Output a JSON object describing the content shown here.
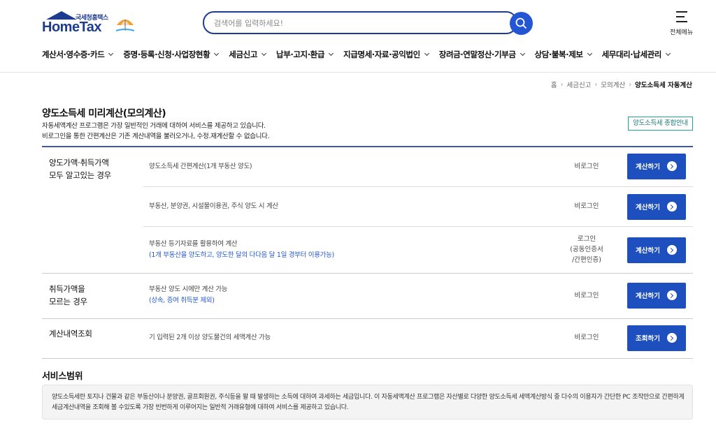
{
  "header": {
    "logo_sub": "국세청홈택스",
    "logo_main": "HomeTax",
    "search_placeholder": "검색어를 입력하세요!",
    "menu_label": "전체메뉴"
  },
  "gnb": [
    {
      "label": "계산서·영수증·카드"
    },
    {
      "label": "증명·등록·신청·사업장현황"
    },
    {
      "label": "세금신고"
    },
    {
      "label": "납부·고지·환급"
    },
    {
      "label": "지급명세·자료·공익법인"
    },
    {
      "label": "장려금·연말정산·기부금"
    },
    {
      "label": "상담·불복·제보"
    },
    {
      "label": "세무대리·납세관리"
    }
  ],
  "breadcrumb": [
    "홈",
    "세금신고",
    "모의계산",
    "양도소득세 자동계산"
  ],
  "page": {
    "title": "양도소득세 미리계산(모의계산)",
    "desc_line1": "자동세액계산 프로그램은 가장 일반적인 거래에 대하여 서비스를 제공하고 있습니다.",
    "desc_line2": "비로그인을 통한 간편계산은 기존 계산내역을 불러오거나, 수정.재계산할 수 없습니다.",
    "guide_button": "양도소득세 종합안내"
  },
  "sections": {
    "known": {
      "label_line1": "양도가액·취득가액",
      "label_line2": "모두 알고있는 경우"
    },
    "unknown": {
      "label_line1": "취득가액을",
      "label_line2": "모르는 경우"
    },
    "history": {
      "label_line1": "계산내역조회"
    }
  },
  "rows": [
    {
      "text": "양도소득세 간편계산(1개 부동산 양도)",
      "note": "",
      "login": "비로그인",
      "button": "계산하기"
    },
    {
      "text": "부동산, 분양권, 시설물이용권, 주식 양도 시 계산",
      "note": "",
      "login": "비로그인",
      "button": "계산하기"
    },
    {
      "text": "부동산 등기자료를 활용하여 계산",
      "note": "(1개 부동산을 양도하고, 양도한 달의 다다음 달 1일 경부터 이용가능)",
      "login_line1": "로그인",
      "login_line2": "(공동인증서",
      "login_line3": "/간편인증)",
      "button": "계산하기"
    },
    {
      "text": "부동산 양도 시에만 계산 가능",
      "note": "(상속, 증여 취득분 제외)",
      "login": "비로그인",
      "button": "계산하기"
    },
    {
      "text": "기 입력된 2개 이상 양도물건의 세액계산 가능",
      "note": "",
      "login": "비로그인",
      "button": "조회하기"
    }
  ],
  "scope": {
    "title": "서비스범위",
    "text": "양도소득세란 토지나 건물과 같은 부동산이나 분양권, 골프회원권, 주식등을 팔 때 발생하는 소득에 대하여 과세하는 세금입니다. 이 자동세액계산 프로그램은 자산별로 다양한 양도소득세 세액계산방식 중 다수의 이용자가 간단한 PC 조작만으로 간편하게 세금계산내역을 조회해 볼 수있도록 가장 빈번하게 이루어지는 일반적 거래유형에 대하여 서비스를 제공하고 있습니다."
  },
  "colors": {
    "brand": "#1e3c8f",
    "button": "#1e4fbf",
    "note": "#2456d3",
    "guide_border": "#20a39e"
  }
}
